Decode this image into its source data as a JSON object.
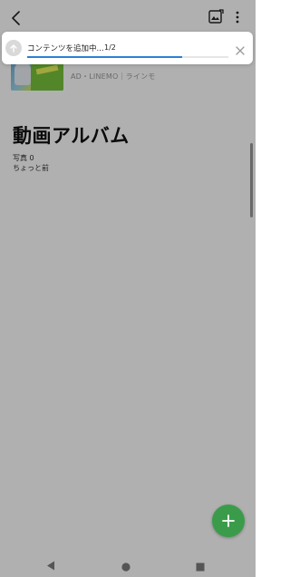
{
  "header": {
    "back_icon": "chevron-left-icon",
    "photo_icon": "photo-edit-icon",
    "more_icon": "more-vert-icon"
  },
  "ad": {
    "text": "AD・LINEMO｜ラインモ"
  },
  "album": {
    "title": "動画アルバム",
    "photo_count": "写真 0",
    "updated": "ちょっと前"
  },
  "upload": {
    "label": "コンテンツを追加中...",
    "count": "1/2",
    "progress": 0.77,
    "icon": "upload-arrow-icon",
    "close_icon": "close-icon"
  },
  "fab": {
    "icon": "plus-icon"
  },
  "navbar": {
    "back_icon": "nav-back-triangle-icon",
    "home_icon": "nav-home-circle-icon",
    "recent_icon": "nav-recent-square-icon"
  },
  "colors": {
    "accent_green": "#3a9c4a",
    "progress_blue": "#2d7fd5",
    "overlay": "#000000"
  }
}
